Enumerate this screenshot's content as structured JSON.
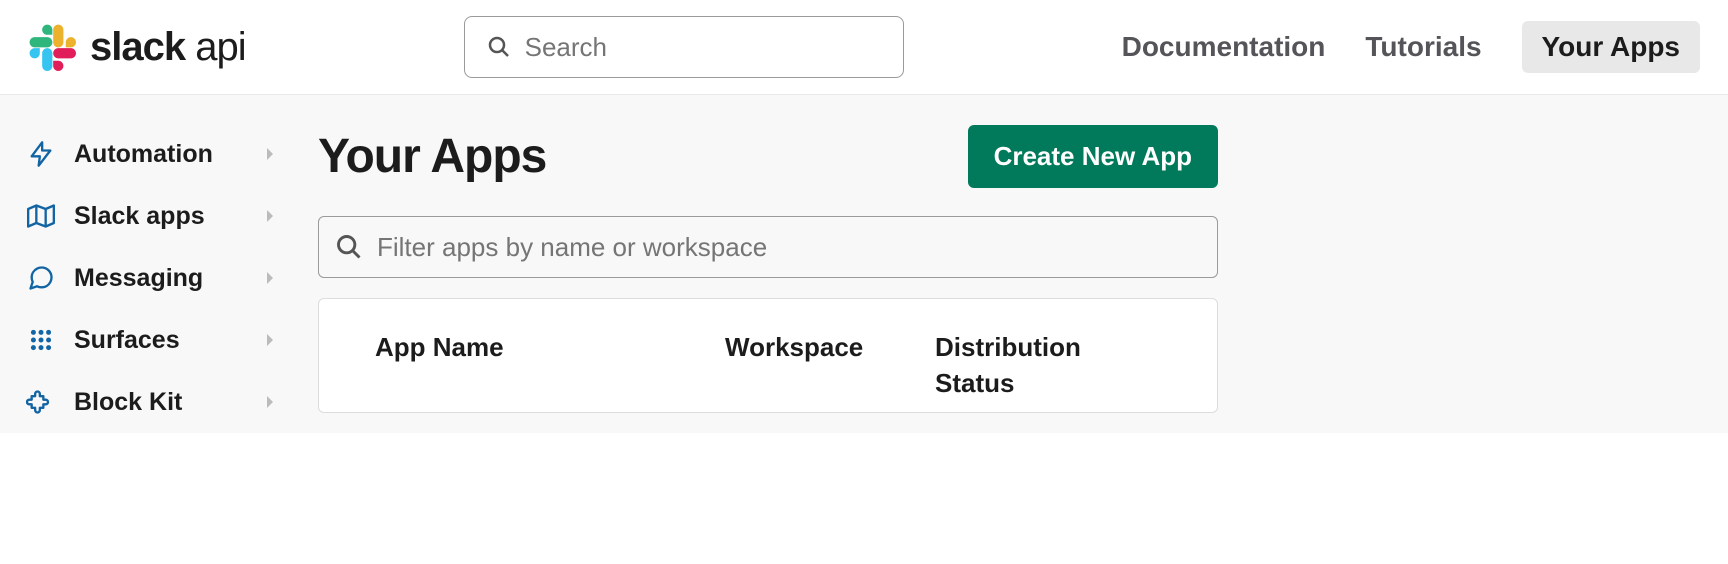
{
  "header": {
    "logo_bold": "slack",
    "logo_light": " api",
    "search_placeholder": "Search",
    "nav": {
      "documentation": "Documentation",
      "tutorials": "Tutorials",
      "your_apps": "Your Apps"
    }
  },
  "sidebar": {
    "items": [
      {
        "label": "Automation"
      },
      {
        "label": "Slack apps"
      },
      {
        "label": "Messaging"
      },
      {
        "label": "Surfaces"
      },
      {
        "label": "Block Kit"
      }
    ]
  },
  "main": {
    "title": "Your Apps",
    "create_button": "Create New App",
    "filter_placeholder": "Filter apps by name or workspace",
    "columns": {
      "app_name": "App Name",
      "workspace": "Workspace",
      "dist_status": "Distribution Status"
    }
  }
}
